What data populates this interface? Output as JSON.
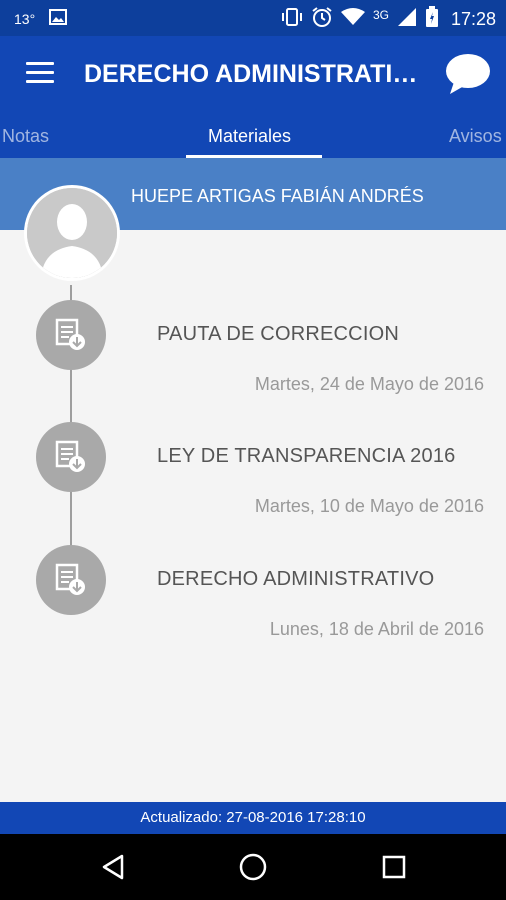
{
  "status_bar": {
    "temperature": "13°",
    "network": "3G",
    "time": "17:28",
    "icons": [
      "image-icon",
      "vibrate-icon",
      "alarm-icon",
      "wifi-icon",
      "signal-icon",
      "battery-icon"
    ]
  },
  "app_bar": {
    "title": "DERECHO ADMINISTRATIVO",
    "menu_icon": "menu-icon",
    "chat_icon": "chat-bubble-icon"
  },
  "tabs": [
    {
      "label": "Notas",
      "selected": false
    },
    {
      "label": "Materiales",
      "selected": true
    },
    {
      "label": "Avisos",
      "selected": false
    }
  ],
  "owner": {
    "name": "HUEPE ARTIGAS FABIÁN ANDRÉS"
  },
  "materials": [
    {
      "title": "PAUTA DE CORRECCION",
      "date": "Martes, 24 de Mayo de 2016",
      "icon": "document-download-icon"
    },
    {
      "title": "LEY DE TRANSPARENCIA 2016",
      "date": "Martes, 10 de Mayo de 2016",
      "icon": "document-download-icon"
    },
    {
      "title": "DERECHO ADMINISTRATIVO",
      "date": "Lunes, 18 de Abril de 2016",
      "icon": "document-download-icon"
    }
  ],
  "footer": {
    "updated": "Actualizado: 27-08-2016 17:28:10"
  },
  "colors": {
    "status_bar": "#0d3f9c",
    "app_bar": "#1247b5",
    "owner_band": "#4a80c6",
    "icon_circle": "#a9a9a9"
  },
  "nav": {
    "back_icon": "back-triangle-icon",
    "home_icon": "home-circle-icon",
    "recents_icon": "recents-square-icon"
  }
}
